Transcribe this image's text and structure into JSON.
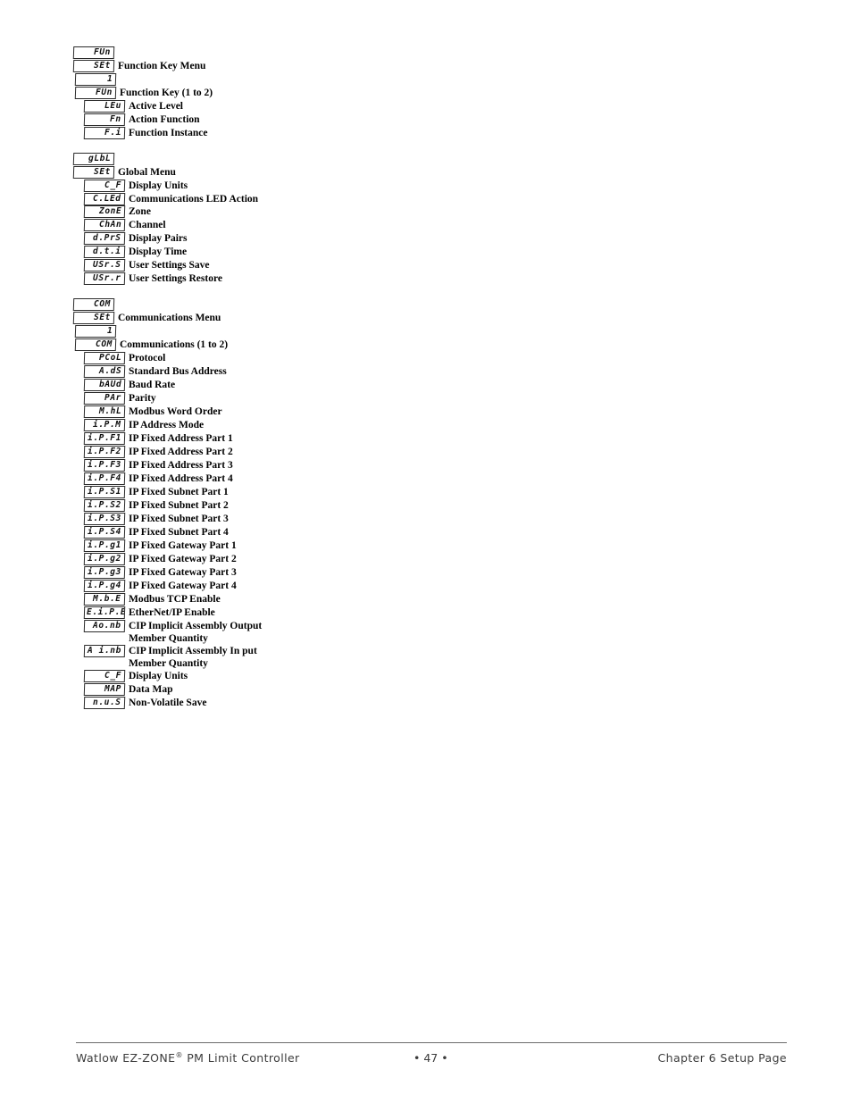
{
  "page": {
    "number": "47"
  },
  "menu_groups": [
    {
      "id": "function-key-menu",
      "rows": [
        {
          "display": "FUn",
          "label": "",
          "level": 0
        },
        {
          "display": "SEt",
          "label": "Function Key Menu",
          "level": 0
        },
        {
          "display": "1",
          "label": "",
          "level": 1
        },
        {
          "display": "FUn",
          "label": "Function Key (1 to 2)",
          "level": 1
        },
        {
          "display": "LEu",
          "label": "Active Level",
          "level": 2
        },
        {
          "display": "Fn",
          "label": "Action Function",
          "level": 2
        },
        {
          "display": "F.i",
          "label": "Function Instance",
          "level": 2
        }
      ]
    },
    {
      "id": "global-menu",
      "rows": [
        {
          "display": "gLbL",
          "label": "",
          "level": 0
        },
        {
          "display": "SEt",
          "label": "Global Menu",
          "level": 0
        },
        {
          "display": "C_F",
          "label": "Display Units",
          "level": 2
        },
        {
          "display": "C.LEd",
          "label": "Communications LED Action",
          "level": 2,
          "wrap": true
        },
        {
          "display": "ZonE",
          "label": "Zone",
          "level": 2
        },
        {
          "display": "ChAn",
          "label": "Channel",
          "level": 2
        },
        {
          "display": "d.PrS",
          "label": "Display Pairs",
          "level": 2
        },
        {
          "display": "d.t.i",
          "label": "Display Time",
          "level": 2
        },
        {
          "display": "USr.S",
          "label": "User Settings Save",
          "level": 2
        },
        {
          "display": "USr.r",
          "label": "User Settings Restore",
          "level": 2
        }
      ]
    },
    {
      "id": "communications-menu",
      "rows": [
        {
          "display": "COM",
          "label": "",
          "level": 0
        },
        {
          "display": "SEt",
          "label": "Communications Menu",
          "level": 0
        },
        {
          "display": "1",
          "label": "",
          "level": 1
        },
        {
          "display": "COM",
          "label": "Communications (1 to 2)",
          "level": 1
        },
        {
          "display": "PCoL",
          "label": "Protocol",
          "level": 2
        },
        {
          "display": "A.dS",
          "label": "Standard Bus Address",
          "level": 2
        },
        {
          "display": "bAUd",
          "label": "Baud Rate",
          "level": 2
        },
        {
          "display": "PAr",
          "label": "Parity",
          "level": 2
        },
        {
          "display": "M.hL",
          "label": "Modbus Word Order",
          "level": 2
        },
        {
          "display": "i.P.M",
          "label": "IP Address Mode",
          "level": 2
        },
        {
          "display": "i.P.F1",
          "label": "IP Fixed Address Part 1",
          "level": 2
        },
        {
          "display": "i.P.F2",
          "label": "IP Fixed Address Part 2",
          "level": 2
        },
        {
          "display": "i.P.F3",
          "label": "IP Fixed Address Part 3",
          "level": 2
        },
        {
          "display": "i.P.F4",
          "label": "IP Fixed Address Part 4",
          "level": 2
        },
        {
          "display": "i.P.S1",
          "label": "IP Fixed Subnet Part 1",
          "level": 2
        },
        {
          "display": "i.P.S2",
          "label": "IP Fixed Subnet Part 2",
          "level": 2
        },
        {
          "display": "i.P.S3",
          "label": "IP Fixed Subnet Part 3",
          "level": 2
        },
        {
          "display": "i.P.S4",
          "label": "IP Fixed Subnet Part 4",
          "level": 2
        },
        {
          "display": "i.P.g1",
          "label": "IP Fixed Gateway Part 1",
          "level": 2
        },
        {
          "display": "i.P.g2",
          "label": "IP Fixed Gateway Part 2",
          "level": 2
        },
        {
          "display": "i.P.g3",
          "label": "IP Fixed Gateway Part 3",
          "level": 2
        },
        {
          "display": "i.P.g4",
          "label": "IP Fixed Gateway Part 4",
          "level": 2
        },
        {
          "display": "M.b.E",
          "label": "Modbus TCP Enable",
          "level": 2
        },
        {
          "display": "E.i.P.E",
          "label": "EtherNet/IP Enable",
          "level": 2
        },
        {
          "display": "Ao.nb",
          "label": "CIP Implicit Assembly Output Member Quantity",
          "level": 2,
          "wrap": true
        },
        {
          "display": "A i.nb",
          "label": "CIP Implicit Assembly In put Member Quantity",
          "level": 2,
          "wrap": true
        },
        {
          "display": "C_F",
          "label": "Display Units",
          "level": 2
        },
        {
          "display": "MAP",
          "label": "Data Map",
          "level": 2
        },
        {
          "display": "n.u.S",
          "label": "Non-Volatile Save",
          "level": 2
        }
      ]
    }
  ],
  "footer": {
    "left_pre": "Watlow EZ-ZONE",
    "left_reg": "®",
    "left_post": " PM Limit Controller",
    "center": "•  47  •",
    "right": "Chapter 6 Setup Page"
  }
}
